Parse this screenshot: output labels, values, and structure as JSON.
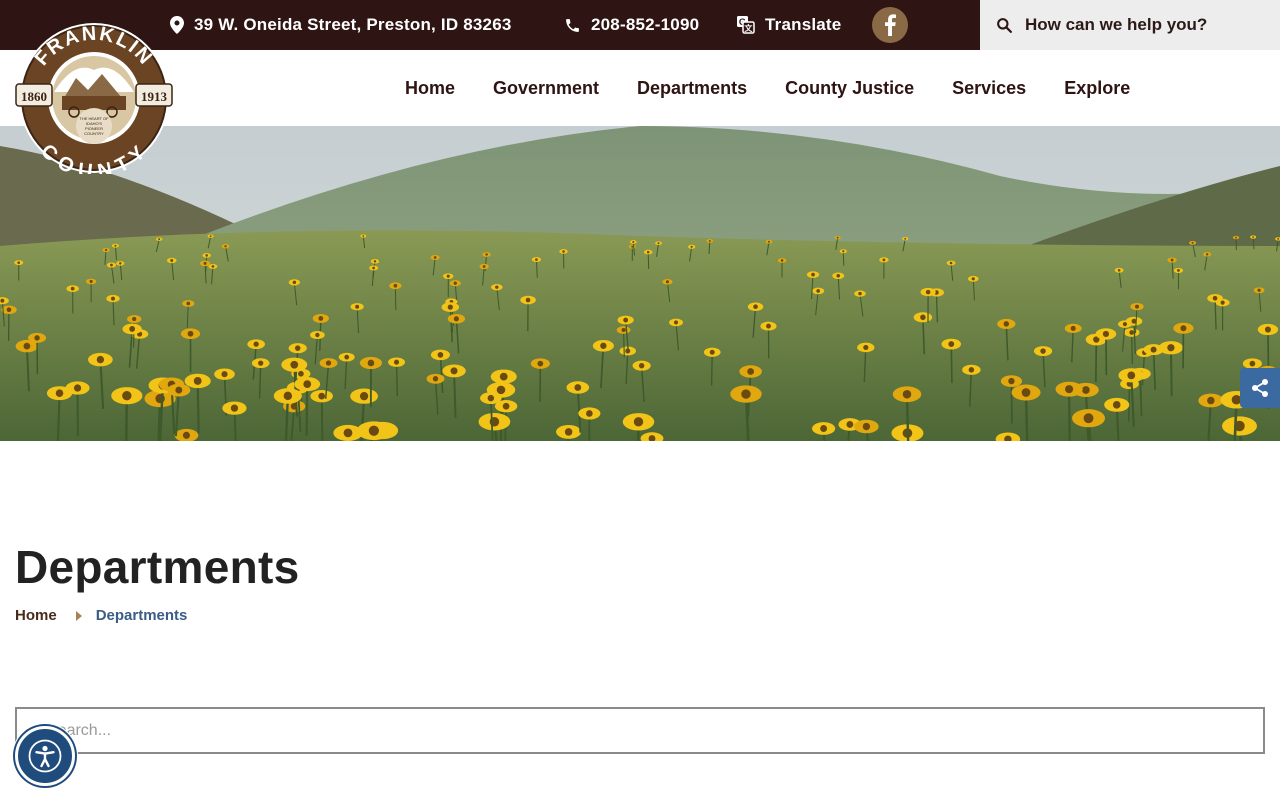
{
  "topbar": {
    "address": "39 W. Oneida Street, Preston, ID 83263",
    "phone": "208-852-1090",
    "translate_label": "Translate",
    "search_placeholder": "How can we help you?"
  },
  "logo": {
    "top_text": "FRANKLIN",
    "bottom_text": "COUNTY",
    "year_left": "1860",
    "year_right": "1913",
    "tagline_lines": [
      "THE HEART OF",
      "IDAHO'S",
      "PIONEER",
      "COUNTRY"
    ]
  },
  "nav": {
    "items": [
      "Home",
      "Government",
      "Departments",
      "County Justice",
      "Services",
      "Explore"
    ]
  },
  "page": {
    "title": "Departments",
    "breadcrumb": [
      "Home",
      "Departments"
    ],
    "search_placeholder": "Search..."
  },
  "colors": {
    "topbar_bg": "#2e1412",
    "accent_brown": "#8a6a46",
    "link_blue": "#3b5c86",
    "share_blue": "#3b6aa0",
    "a11y_blue": "#1f4c7c"
  },
  "icons": [
    "map-pin-icon",
    "phone-icon",
    "translate-icon",
    "facebook-icon",
    "search-icon",
    "share-icon",
    "accessibility-icon"
  ]
}
